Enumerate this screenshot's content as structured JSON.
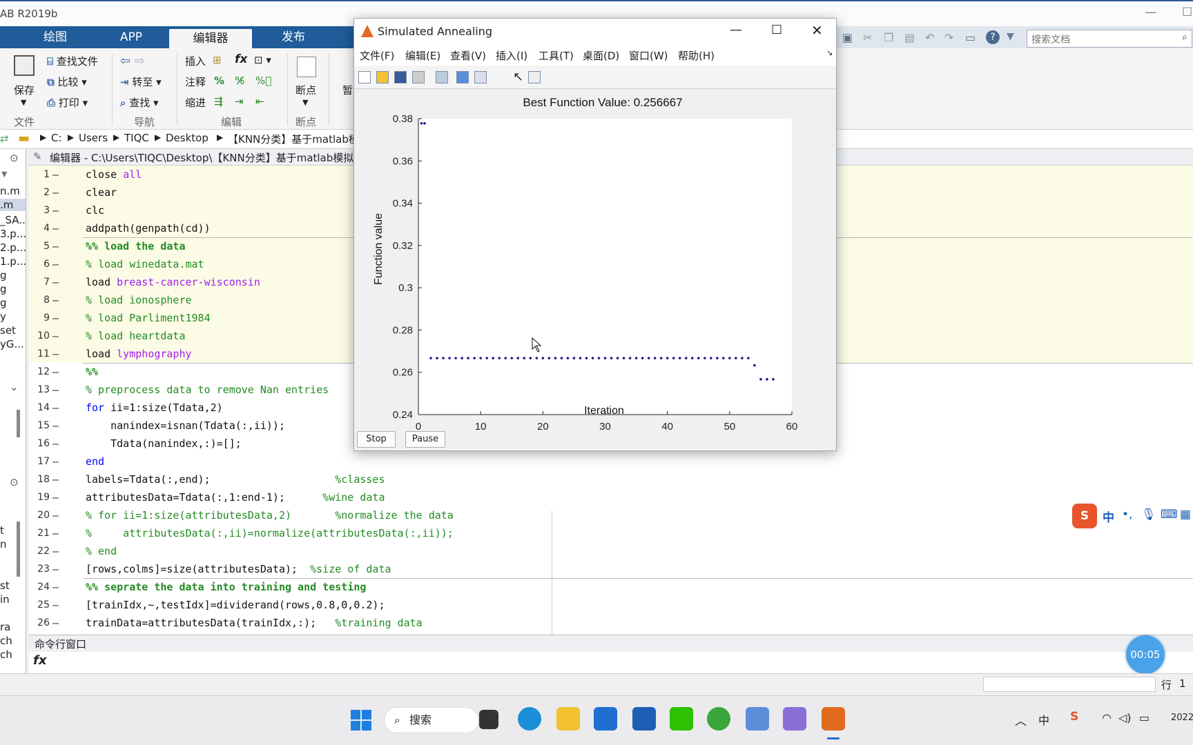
{
  "window": {
    "title_partial": "AB R2019b"
  },
  "ribbon": {
    "tabs": [
      "绘图",
      "APP",
      "编辑器",
      "发布"
    ],
    "file_group": {
      "save": "保存",
      "find_files": "查找文件",
      "compare": "比较",
      "print": "打印",
      "label": "文件"
    },
    "nav_group": {
      "goto": "转至",
      "find": "查找",
      "label": "导航"
    },
    "edit_group": {
      "insert": "插入",
      "comment": "注释",
      "indent": "缩进",
      "label": "编辑",
      "fx": "fx"
    },
    "breakpoint_group": {
      "breakpoints": "断点",
      "label": "断点",
      "pause_partial": "暂"
    },
    "search_placeholder": "搜索文档"
  },
  "path": [
    "C:",
    "Users",
    "TIQC",
    "Desktop",
    "【KNN分类】基于matlab模"
  ],
  "left_panel": {
    "files": [
      "n.m",
      ".m",
      "_SA...",
      "3.p...",
      "2.p...",
      "1.p...",
      "g",
      "g",
      "g",
      "y",
      "set",
      "yG..."
    ],
    "lower": [
      "t",
      "n",
      "st",
      "in",
      "ra",
      "ch",
      "ch"
    ]
  },
  "editor": {
    "header": "编辑器 - C:\\Users\\TIQC\\Desktop\\【KNN分类】基于matlab模拟退",
    "lines": [
      {
        "n": "1",
        "segs": [
          {
            "t": "close ",
            "c": ""
          },
          {
            "t": "all",
            "c": "str"
          }
        ]
      },
      {
        "n": "2",
        "segs": [
          {
            "t": "clear",
            "c": ""
          }
        ]
      },
      {
        "n": "3",
        "segs": [
          {
            "t": "clc",
            "c": ""
          }
        ]
      },
      {
        "n": "4",
        "segs": [
          {
            "t": "addpath(genpath(cd))",
            "c": ""
          }
        ]
      },
      {
        "n": "5",
        "segs": [
          {
            "t": "%% load the data",
            "c": "cell"
          }
        ]
      },
      {
        "n": "6",
        "segs": [
          {
            "t": "% load winedata.mat",
            "c": "cm"
          }
        ]
      },
      {
        "n": "7",
        "segs": [
          {
            "t": "load ",
            "c": ""
          },
          {
            "t": "breast-cancer-wisconsin",
            "c": "str"
          }
        ]
      },
      {
        "n": "8",
        "segs": [
          {
            "t": "% load ionosphere",
            "c": "cm"
          }
        ]
      },
      {
        "n": "9",
        "segs": [
          {
            "t": "% load Parliment1984",
            "c": "cm"
          }
        ]
      },
      {
        "n": "10",
        "segs": [
          {
            "t": "% load heartdata",
            "c": "cm"
          }
        ]
      },
      {
        "n": "11",
        "segs": [
          {
            "t": "load ",
            "c": ""
          },
          {
            "t": "lymphography",
            "c": "str"
          }
        ]
      },
      {
        "n": "12",
        "segs": [
          {
            "t": "%%",
            "c": "cell"
          }
        ]
      },
      {
        "n": "13",
        "segs": [
          {
            "t": "% preprocess data to remove Nan entries",
            "c": "cm"
          }
        ]
      },
      {
        "n": "14",
        "segs": [
          {
            "t": "for",
            "c": "kw"
          },
          {
            "t": " ii=1:size(Tdata,2)",
            "c": ""
          }
        ]
      },
      {
        "n": "15",
        "segs": [
          {
            "t": "    nanindex=isnan(Tdata(:,ii));",
            "c": ""
          }
        ]
      },
      {
        "n": "16",
        "segs": [
          {
            "t": "    Tdata(nanindex,:)=[];",
            "c": ""
          }
        ]
      },
      {
        "n": "17",
        "segs": [
          {
            "t": "end",
            "c": "kw"
          }
        ]
      },
      {
        "n": "18",
        "segs": [
          {
            "t": "labels=Tdata(:,end);                    ",
            "c": ""
          },
          {
            "t": "%classes",
            "c": "cm"
          }
        ]
      },
      {
        "n": "19",
        "segs": [
          {
            "t": "attributesData=Tdata(:,1:end-1);      ",
            "c": ""
          },
          {
            "t": "%wine data",
            "c": "cm"
          }
        ]
      },
      {
        "n": "20",
        "segs": [
          {
            "t": "% for ii=1:size(attributesData,2)       %normalize the data",
            "c": "cm"
          }
        ]
      },
      {
        "n": "21",
        "segs": [
          {
            "t": "%     attributesData(:,ii)=normalize(attributesData(:,ii));",
            "c": "cm"
          }
        ]
      },
      {
        "n": "22",
        "segs": [
          {
            "t": "% end",
            "c": "cm"
          }
        ]
      },
      {
        "n": "23",
        "segs": [
          {
            "t": "[rows,colms]=size(attributesData);  ",
            "c": ""
          },
          {
            "t": "%size of data",
            "c": "cm"
          }
        ]
      },
      {
        "n": "24",
        "segs": [
          {
            "t": "%% seprate the data into training and testing",
            "c": "cell"
          }
        ]
      },
      {
        "n": "25",
        "segs": [
          {
            "t": "[trainIdx,~,testIdx]=dividerand(rows,0.8,0,0.2);",
            "c": ""
          }
        ]
      },
      {
        "n": "26",
        "segs": [
          {
            "t": "trainData=attributesData(trainIdx,:);   ",
            "c": ""
          },
          {
            "t": "%training data",
            "c": "cm"
          }
        ]
      }
    ]
  },
  "command_window": {
    "label": "命令行窗口",
    "prompt": "fx"
  },
  "status": {
    "row_label": "行",
    "row_value": "1"
  },
  "timer": "00:05",
  "ime": {
    "mode": "中"
  },
  "taskbar": {
    "search": "搜索",
    "year_partial": "2022"
  },
  "dialog": {
    "title": "Simulated Annealing",
    "menu": [
      "文件(F)",
      "编辑(E)",
      "查看(V)",
      "插入(I)",
      "工具(T)",
      "桌面(D)",
      "窗口(W)",
      "帮助(H)"
    ],
    "stop": "Stop",
    "pause": "Pause"
  },
  "chart_data": {
    "type": "scatter",
    "title": "Best Function Value: 0.256667",
    "xlabel": "Iteration",
    "ylabel": "Function value",
    "xlim": [
      0,
      60
    ],
    "ylim": [
      0.24,
      0.38
    ],
    "xticks": [
      "0",
      "10",
      "20",
      "30",
      "40",
      "50",
      "60"
    ],
    "yticks": [
      "0.24",
      "0.26",
      "0.28",
      "0.3",
      "0.32",
      "0.34",
      "0.36",
      "0.38"
    ],
    "marker_color": "#1a1a8c",
    "series": [
      {
        "x": [
          0.5,
          1,
          2,
          3,
          4,
          5,
          6,
          7,
          8,
          9,
          10,
          11,
          12,
          13,
          14,
          15,
          16,
          17,
          18,
          19,
          20,
          21,
          22,
          23,
          24,
          25,
          26,
          27,
          28,
          29,
          30,
          31,
          32,
          33,
          34,
          35,
          36,
          37,
          38,
          39,
          40,
          41,
          42,
          43,
          44,
          45,
          46,
          47,
          48,
          49,
          50,
          51,
          52,
          53,
          54,
          55,
          56,
          57
        ],
        "y": [
          0.3778,
          0.3778,
          0.2667,
          0.2667,
          0.2667,
          0.2667,
          0.2667,
          0.2667,
          0.2667,
          0.2667,
          0.2667,
          0.2667,
          0.2667,
          0.2667,
          0.2667,
          0.2667,
          0.2667,
          0.2667,
          0.2667,
          0.2667,
          0.2667,
          0.2667,
          0.2667,
          0.2667,
          0.2667,
          0.2667,
          0.2667,
          0.2667,
          0.2667,
          0.2667,
          0.2667,
          0.2667,
          0.2667,
          0.2667,
          0.2667,
          0.2667,
          0.2667,
          0.2667,
          0.2667,
          0.2667,
          0.2667,
          0.2667,
          0.2667,
          0.2667,
          0.2667,
          0.2667,
          0.2667,
          0.2667,
          0.2667,
          0.2667,
          0.2667,
          0.2667,
          0.2667,
          0.2667,
          0.2633,
          0.2567,
          0.2567,
          0.2567
        ]
      }
    ]
  }
}
